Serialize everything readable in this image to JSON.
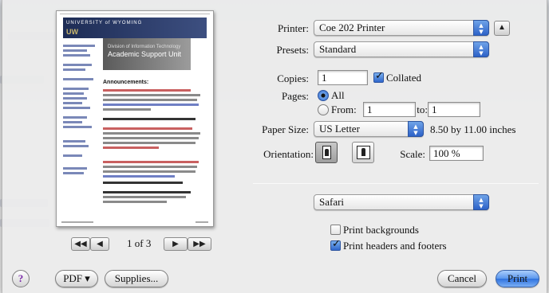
{
  "printer": {
    "label": "Printer:",
    "value": "Coe 202 Printer"
  },
  "presets": {
    "label": "Presets:",
    "value": "Standard"
  },
  "copies": {
    "label": "Copies:",
    "value": "1",
    "collated_label": "Collated",
    "collated": true
  },
  "pages": {
    "label": "Pages:",
    "all_label": "All",
    "all_selected": true,
    "from_label": "From:",
    "from_value": "1",
    "to_label": "to:",
    "to_value": "1"
  },
  "paper_size": {
    "label": "Paper Size:",
    "value": "US Letter",
    "dimensions": "8.50 by 11.00 inches"
  },
  "orientation": {
    "label": "Orientation:",
    "selected": "portrait"
  },
  "scale": {
    "label": "Scale:",
    "value": "100 %"
  },
  "panel": {
    "value": "Safari"
  },
  "options": {
    "print_backgrounds_label": "Print backgrounds",
    "print_backgrounds": false,
    "print_headers_label": "Print headers and footers",
    "print_headers": true
  },
  "preview": {
    "page_current": "1",
    "page_of": "of",
    "page_total": "3",
    "first_label": "◀◀",
    "prev_label": "◀",
    "next_label": "▶",
    "last_label": "▶▶",
    "banner_line1": "UNIVERSITY of WYOMING",
    "banner_line2": "UW",
    "hero_line1": "Division of Information Technology",
    "hero_line2": "Academic Support Unit",
    "heading": "Announcements:"
  },
  "footer": {
    "help_label": "?",
    "pdf_label": "PDF ▾",
    "supplies_label": "Supplies...",
    "cancel_label": "Cancel",
    "print_label": "Print"
  },
  "colors": {
    "accent": "#2f66cc",
    "banner": "#1d2c55"
  }
}
